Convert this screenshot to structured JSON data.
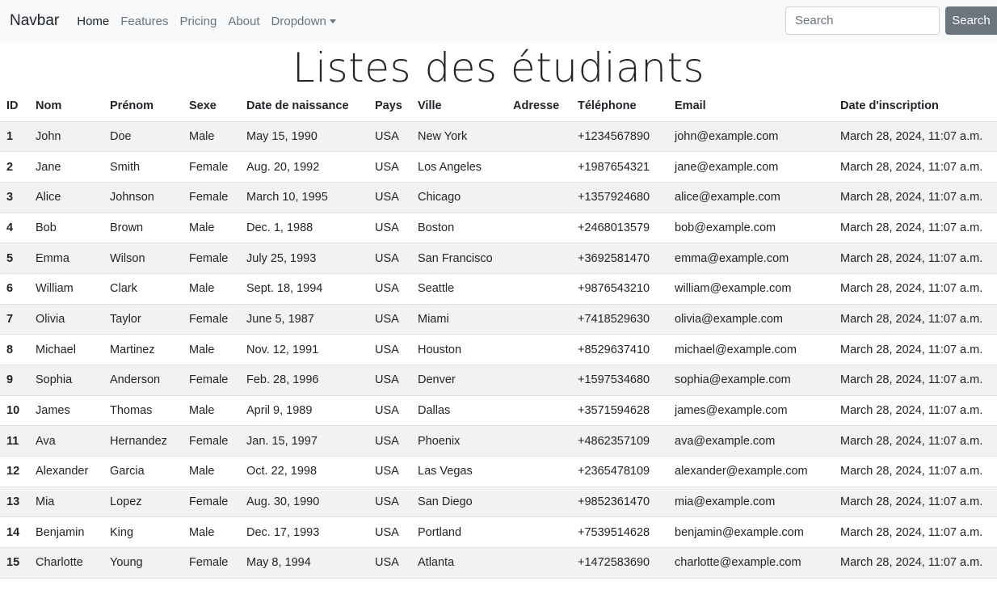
{
  "navbar": {
    "brand": "Navbar",
    "links": [
      "Home",
      "Features",
      "Pricing",
      "About"
    ],
    "dropdown_label": "Dropdown",
    "search_placeholder": "Search",
    "search_button": "Search"
  },
  "title": "Listes des étudiants",
  "table": {
    "headers": [
      "ID",
      "Nom",
      "Prénom",
      "Sexe",
      "Date de naissance",
      "Pays",
      "Ville",
      "Adresse",
      "Téléphone",
      "Email",
      "Date d'inscription"
    ],
    "rows": [
      [
        "1",
        "John",
        "Doe",
        "Male",
        "May 15, 1990",
        "USA",
        "New York",
        "",
        "+1234567890",
        "john@example.com",
        "March 28, 2024, 11:07 a.m."
      ],
      [
        "2",
        "Jane",
        "Smith",
        "Female",
        "Aug. 20, 1992",
        "USA",
        "Los Angeles",
        "",
        "+1987654321",
        "jane@example.com",
        "March 28, 2024, 11:07 a.m."
      ],
      [
        "3",
        "Alice",
        "Johnson",
        "Female",
        "March 10, 1995",
        "USA",
        "Chicago",
        "",
        "+1357924680",
        "alice@example.com",
        "March 28, 2024, 11:07 a.m."
      ],
      [
        "4",
        "Bob",
        "Brown",
        "Male",
        "Dec. 1, 1988",
        "USA",
        "Boston",
        "",
        "+2468013579",
        "bob@example.com",
        "March 28, 2024, 11:07 a.m."
      ],
      [
        "5",
        "Emma",
        "Wilson",
        "Female",
        "July 25, 1993",
        "USA",
        "San Francisco",
        "",
        "+3692581470",
        "emma@example.com",
        "March 28, 2024, 11:07 a.m."
      ],
      [
        "6",
        "William",
        "Clark",
        "Male",
        "Sept. 18, 1994",
        "USA",
        "Seattle",
        "",
        "+9876543210",
        "william@example.com",
        "March 28, 2024, 11:07 a.m."
      ],
      [
        "7",
        "Olivia",
        "Taylor",
        "Female",
        "June 5, 1987",
        "USA",
        "Miami",
        "",
        "+7418529630",
        "olivia@example.com",
        "March 28, 2024, 11:07 a.m."
      ],
      [
        "8",
        "Michael",
        "Martinez",
        "Male",
        "Nov. 12, 1991",
        "USA",
        "Houston",
        "",
        "+8529637410",
        "michael@example.com",
        "March 28, 2024, 11:07 a.m."
      ],
      [
        "9",
        "Sophia",
        "Anderson",
        "Female",
        "Feb. 28, 1996",
        "USA",
        "Denver",
        "",
        "+1597534680",
        "sophia@example.com",
        "March 28, 2024, 11:07 a.m."
      ],
      [
        "10",
        "James",
        "Thomas",
        "Male",
        "April 9, 1989",
        "USA",
        "Dallas",
        "",
        "+3571594628",
        "james@example.com",
        "March 28, 2024, 11:07 a.m."
      ],
      [
        "11",
        "Ava",
        "Hernandez",
        "Female",
        "Jan. 15, 1997",
        "USA",
        "Phoenix",
        "",
        "+4862357109",
        "ava@example.com",
        "March 28, 2024, 11:07 a.m."
      ],
      [
        "12",
        "Alexander",
        "Garcia",
        "Male",
        "Oct. 22, 1998",
        "USA",
        "Las Vegas",
        "",
        "+2365478109",
        "alexander@example.com",
        "March 28, 2024, 11:07 a.m."
      ],
      [
        "13",
        "Mia",
        "Lopez",
        "Female",
        "Aug. 30, 1990",
        "USA",
        "San Diego",
        "",
        "+9852361470",
        "mia@example.com",
        "March 28, 2024, 11:07 a.m."
      ],
      [
        "14",
        "Benjamin",
        "King",
        "Male",
        "Dec. 17, 1993",
        "USA",
        "Portland",
        "",
        "+7539514628",
        "benjamin@example.com",
        "March 28, 2024, 11:07 a.m."
      ],
      [
        "15",
        "Charlotte",
        "Young",
        "Female",
        "May 8, 1994",
        "USA",
        "Atlanta",
        "",
        "+1472583690",
        "charlotte@example.com",
        "March 28, 2024, 11:07 a.m."
      ]
    ]
  }
}
